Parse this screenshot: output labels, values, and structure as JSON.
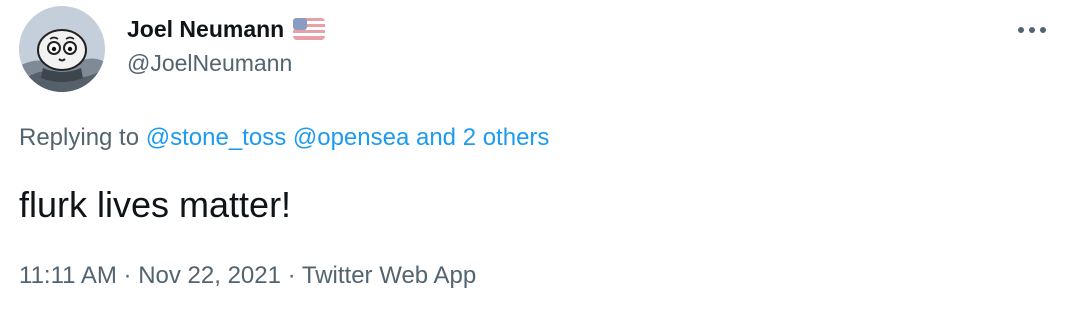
{
  "author": {
    "display_name": "Joel Neumann",
    "handle": "@JoelNeumann",
    "flag_icon": "us-flag-icon"
  },
  "menu": {
    "icon": "more-horizontal-icon"
  },
  "reply": {
    "prefix": "Replying to",
    "mention_1": "@stone_toss",
    "mention_2": "@opensea",
    "others": "and 2 others"
  },
  "tweet": {
    "text": "flurk lives matter!"
  },
  "meta": {
    "time": "11:11 AM",
    "separator": "·",
    "date": "Nov 22, 2021",
    "source": "Twitter Web App"
  },
  "colors": {
    "link": "#1d9bf0",
    "secondary_text": "#536471",
    "primary_text": "#0f1419"
  }
}
